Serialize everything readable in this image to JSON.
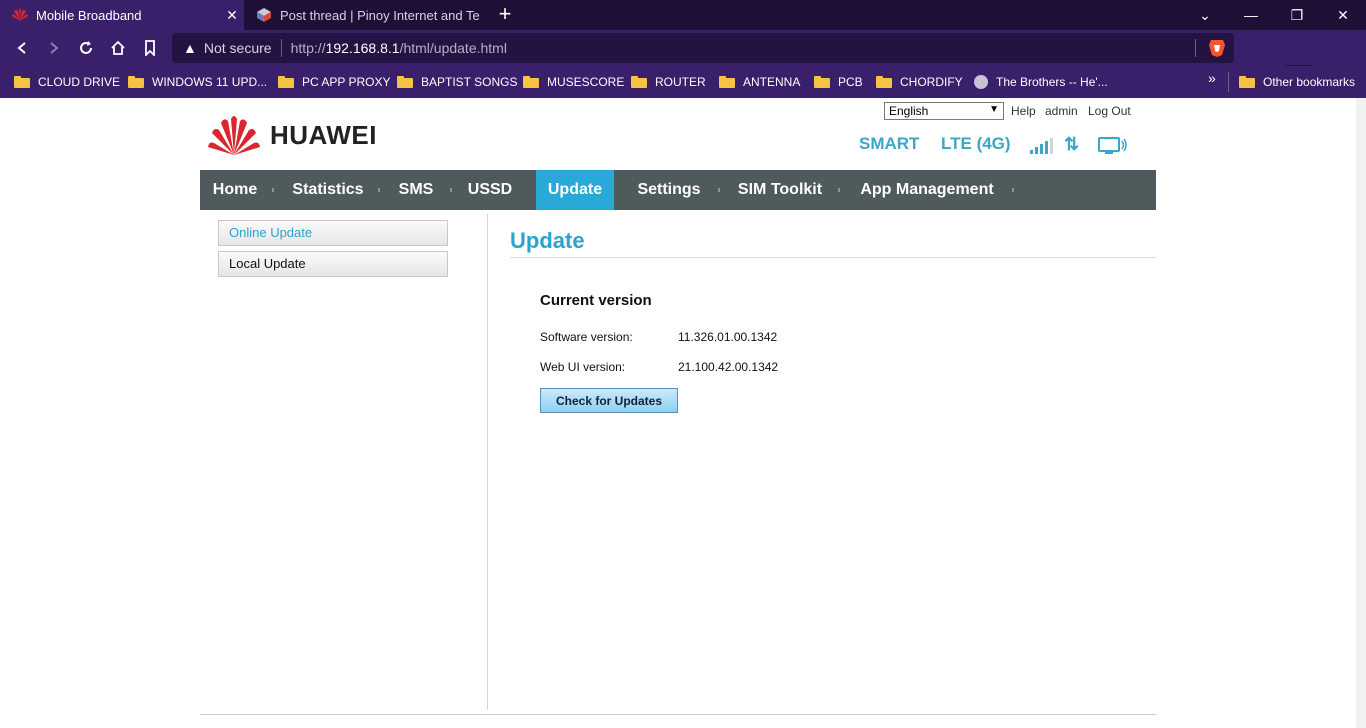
{
  "browser": {
    "tabs": [
      {
        "title": "Mobile Broadband",
        "icon": "huawei-favicon"
      },
      {
        "title": "Post thread | Pinoy Internet and Techn",
        "icon": "forum-favicon"
      }
    ],
    "new_tab": "+",
    "window_controls": {
      "dropdown": "⌄",
      "minimize": "—",
      "restore": "❐",
      "close": "✕"
    },
    "url": {
      "security": "Not secure",
      "scheme": "http://",
      "host": "192.168.8.1",
      "path": "/html/update.html"
    },
    "profile_glyph": "▬▬",
    "bookmarks": [
      "CLOUD DRIVE",
      "WINDOWS 11 UPD...",
      "PC APP PROXY",
      "BAPTIST SONGS",
      "MUSESCORE",
      "ROUTER",
      "ANTENNA",
      "PCB",
      "CHORDIFY",
      "The Brothers -- He'...",
      "Other bookmarks"
    ],
    "more_bookmarks": "»"
  },
  "header": {
    "language": "English",
    "help": "Help",
    "user": "admin",
    "logout": "Log Out",
    "logo_text": "HUAWEI",
    "operator": "SMART",
    "network": "LTE (4G)",
    "transfer_glyph": "⇅"
  },
  "nav": [
    "Home",
    "Statistics",
    "SMS",
    "USSD",
    "Update",
    "Settings",
    "SIM Toolkit",
    "App Management"
  ],
  "nav_active": "Update",
  "sidebar": [
    "Online Update",
    "Local Update"
  ],
  "content": {
    "title": "Update",
    "section": "Current version",
    "software_label": "Software version:",
    "software_value": "11.326.01.00.1342",
    "webui_label": "Web UI version:",
    "webui_value": "21.100.42.00.1342",
    "check_button": "Check for Updates"
  },
  "colors": {
    "accent": "#29a9d8",
    "nav_bg": "#4f5a5d",
    "browser_bg": "#3a1f6b"
  }
}
